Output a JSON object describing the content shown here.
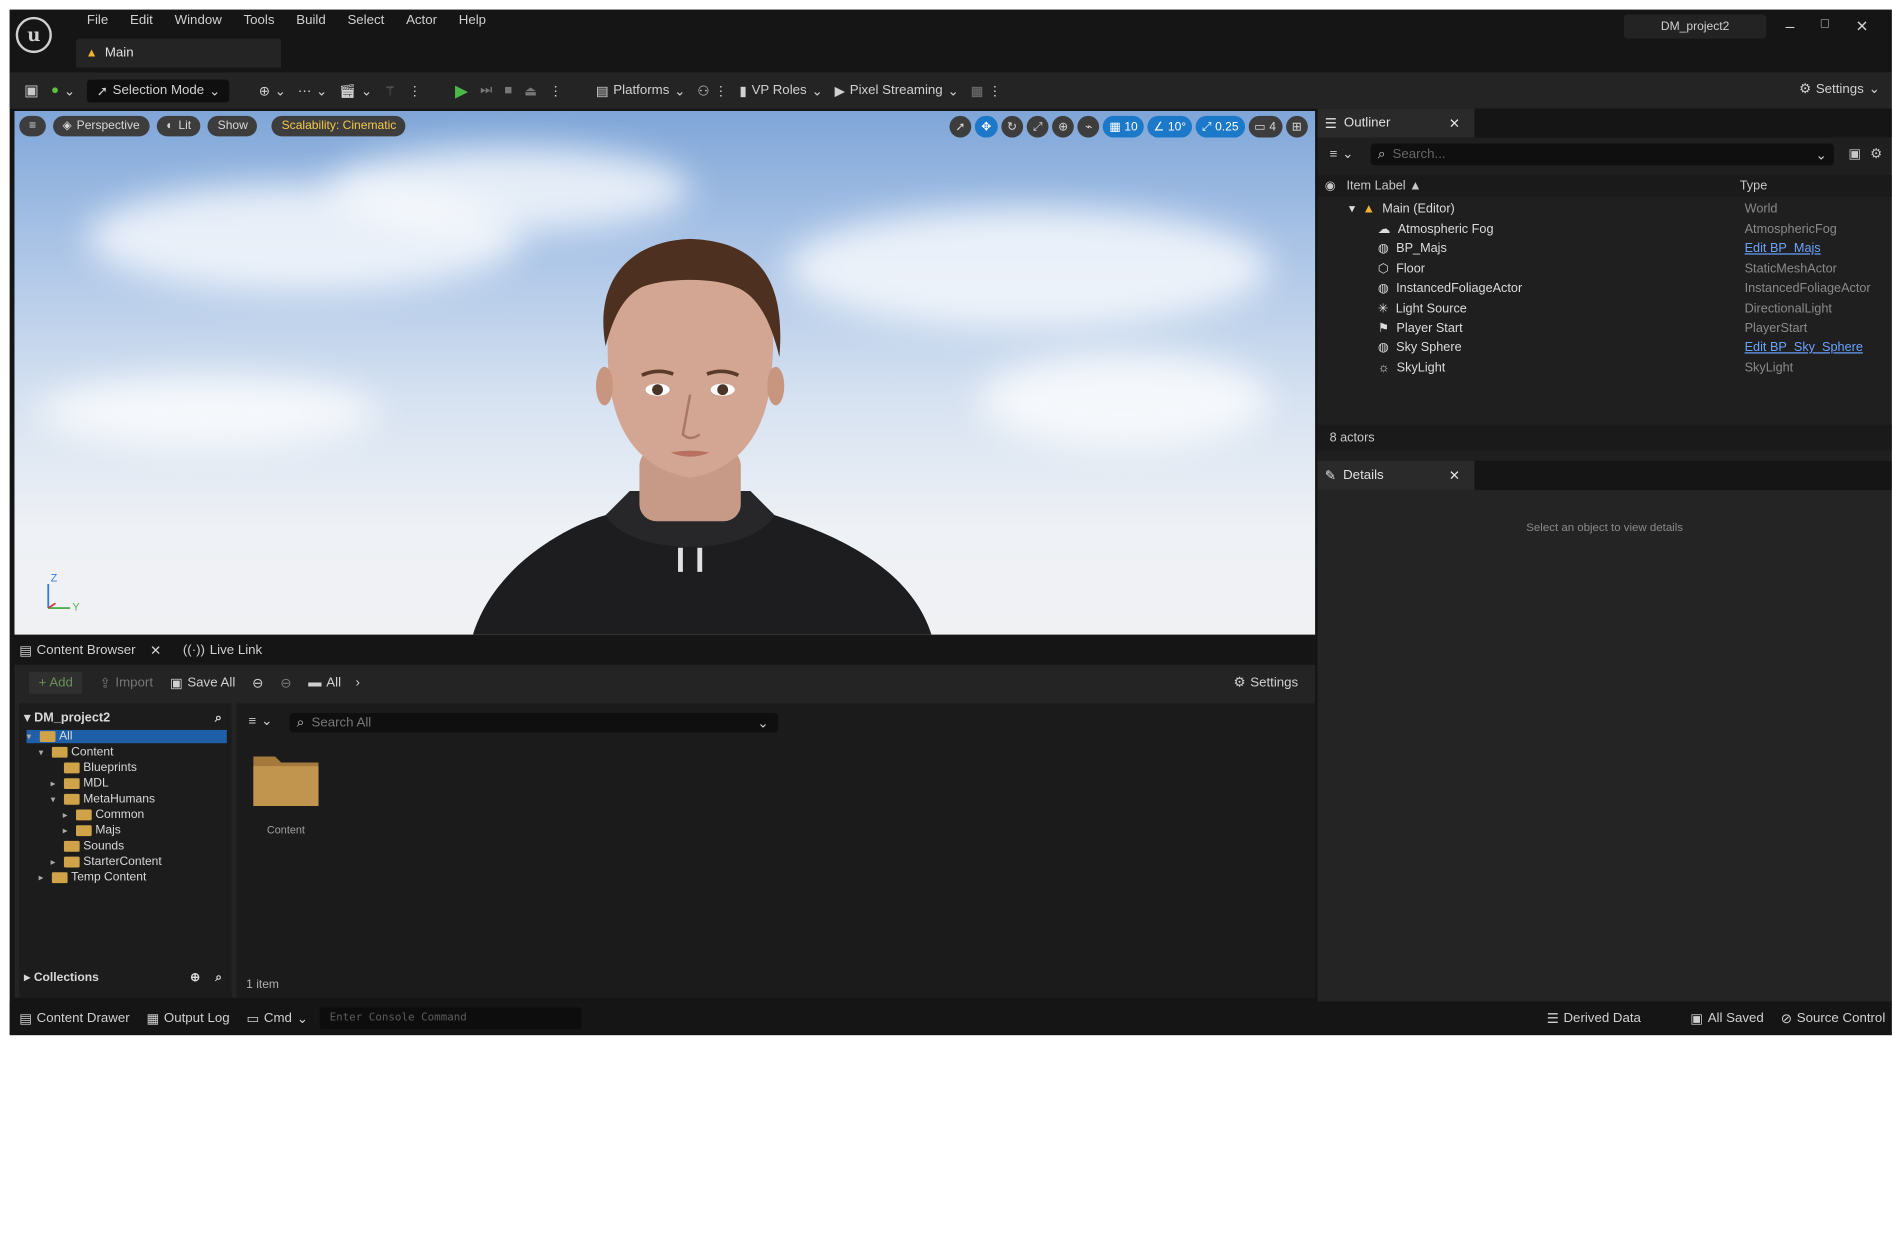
{
  "app": {
    "logo": "u",
    "project_name": "DM_project2",
    "level_tab": "Main",
    "window_controls": {
      "minimize": "–",
      "restore": "□",
      "close": "✕"
    }
  },
  "menu": [
    "File",
    "Edit",
    "Window",
    "Tools",
    "Build",
    "Select",
    "Actor",
    "Help"
  ],
  "toolbar": {
    "selection_mode": "Selection Mode",
    "platforms": "Platforms",
    "vp_roles": "VP Roles",
    "pixel_streaming": "Pixel Streaming",
    "settings": "Settings"
  },
  "viewport": {
    "perspective": "Perspective",
    "lit": "Lit",
    "show": "Show",
    "scalability": "Scalability: Cinematic",
    "grid_snap": "10",
    "rotation_snap": "10°",
    "scale_snap": "0.25",
    "camera_speed": "4",
    "axis_z": "Z",
    "axis_y": "Y"
  },
  "content_browser": {
    "tab_label": "Content Browser",
    "live_link_tab": "Live Link",
    "add_label": "+ Add",
    "import_label": "Import",
    "save_all_label": "Save All",
    "path_label": "All",
    "settings_label": "Settings",
    "search_placeholder": "Search All",
    "root_label": "DM_project2",
    "tree": [
      {
        "label": "All",
        "depth": 0,
        "selected": true,
        "has_arrow": true,
        "open": true
      },
      {
        "label": "Content",
        "depth": 1,
        "selected": false,
        "has_arrow": true,
        "open": true
      },
      {
        "label": "Blueprints",
        "depth": 2,
        "selected": false,
        "has_arrow": false,
        "open": false
      },
      {
        "label": "MDL",
        "depth": 2,
        "selected": false,
        "has_arrow": true,
        "open": false
      },
      {
        "label": "MetaHumans",
        "depth": 2,
        "selected": false,
        "has_arrow": true,
        "open": true
      },
      {
        "label": "Common",
        "depth": 3,
        "selected": false,
        "has_arrow": true,
        "open": false
      },
      {
        "label": "Majs",
        "depth": 3,
        "selected": false,
        "has_arrow": true,
        "open": false
      },
      {
        "label": "Sounds",
        "depth": 2,
        "selected": false,
        "has_arrow": false,
        "open": false
      },
      {
        "label": "StarterContent",
        "depth": 2,
        "selected": false,
        "has_arrow": true,
        "open": false
      },
      {
        "label": "Temp Content",
        "depth": 1,
        "selected": false,
        "has_arrow": true,
        "open": false
      }
    ],
    "collections_label": "Collections",
    "items": [
      {
        "label": "Content"
      }
    ],
    "item_count": "1 item"
  },
  "outliner": {
    "tab_label": "Outliner",
    "search_placeholder": "Search...",
    "col_label": "Item Label ▲",
    "col_type": "Type",
    "root": {
      "name": "Main (Editor)",
      "type": "World"
    },
    "actors": [
      {
        "name": "Atmospheric Fog",
        "type": "AtmosphericFog",
        "link": false,
        "icon": "fog-icon"
      },
      {
        "name": "BP_Majs",
        "type": "Edit BP_Majs",
        "link": true,
        "icon": "actor-icon"
      },
      {
        "name": "Floor",
        "type": "StaticMeshActor",
        "link": false,
        "icon": "mesh-icon"
      },
      {
        "name": "InstancedFoliageActor",
        "type": "InstancedFoliageActor",
        "link": false,
        "icon": "actor-icon"
      },
      {
        "name": "Light Source",
        "type": "DirectionalLight",
        "link": false,
        "icon": "light-icon"
      },
      {
        "name": "Player Start",
        "type": "PlayerStart",
        "link": false,
        "icon": "flag-icon"
      },
      {
        "name": "Sky Sphere",
        "type": "Edit BP_Sky_Sphere",
        "link": true,
        "icon": "actor-icon"
      },
      {
        "name": "SkyLight",
        "type": "SkyLight",
        "link": false,
        "icon": "skylight-icon"
      }
    ],
    "actor_count": "8 actors"
  },
  "details": {
    "tab_label": "Details",
    "empty_message": "Select an object to view details"
  },
  "statusbar": {
    "content_drawer": "Content Drawer",
    "output_log": "Output Log",
    "cmd": "Cmd",
    "console_placeholder": "Enter Console Command",
    "derived_data": "Derived Data",
    "all_saved": "All Saved",
    "source_control": "Source Control"
  }
}
